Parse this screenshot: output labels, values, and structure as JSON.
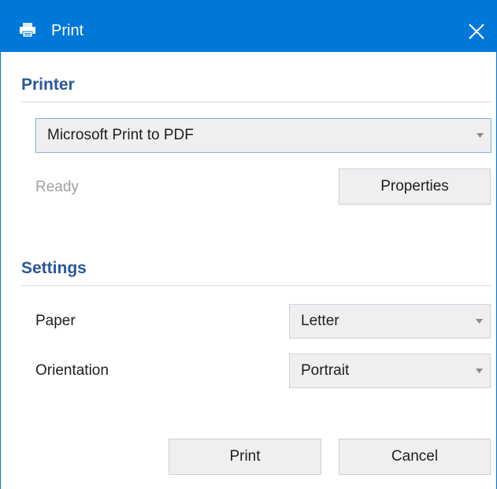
{
  "window": {
    "title": "Print",
    "title_icon": "printer-icon",
    "close_icon": "close-icon"
  },
  "printer_section": {
    "heading": "Printer",
    "selected_printer": "Microsoft Print to PDF",
    "status": "Ready",
    "properties_label": "Properties"
  },
  "settings_section": {
    "heading": "Settings",
    "paper_label": "Paper",
    "paper_value": "Letter",
    "orientation_label": "Orientation",
    "orientation_value": "Portrait"
  },
  "actions": {
    "print_label": "Print",
    "cancel_label": "Cancel"
  },
  "colors": {
    "titlebar": "#0078d7",
    "section_heading": "#2b579a",
    "status_text": "#a0a0a0",
    "control_background": "#efeff2"
  }
}
